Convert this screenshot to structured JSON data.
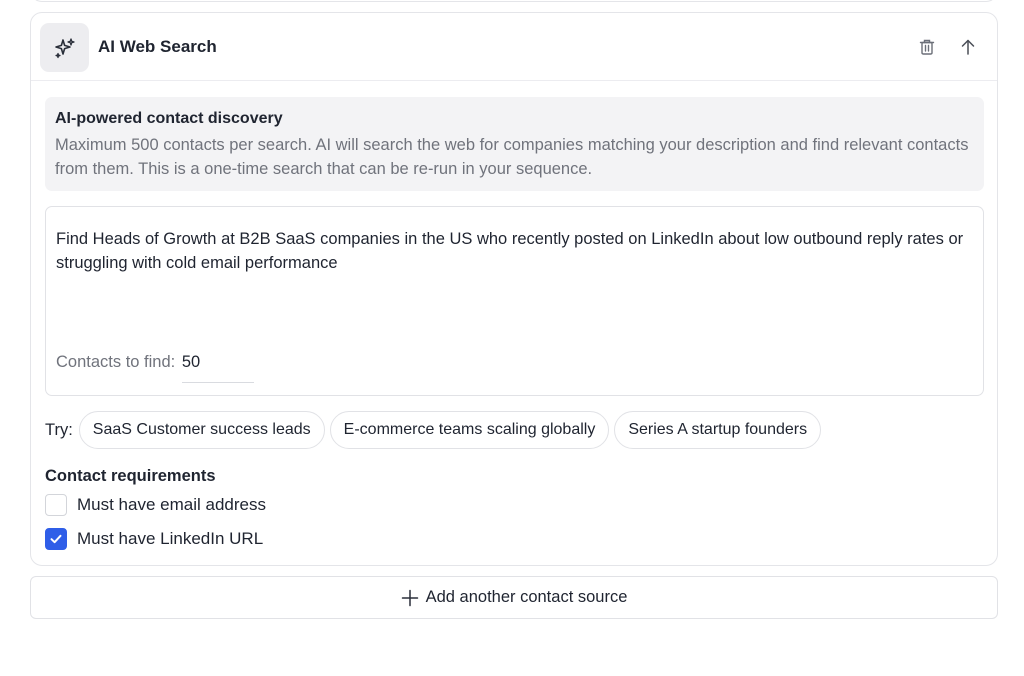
{
  "card": {
    "title": "AI Web Search",
    "header_icon": "sparkles-icon",
    "delete_icon": "trash-icon",
    "move_up_icon": "arrow-up-icon"
  },
  "info": {
    "title": "AI-powered contact discovery",
    "text": "Maximum 500 contacts per search. AI will search the web for companies matching your description and find relevant contacts from them. This is a one-time search that can be re-run in your sequence."
  },
  "prompt": {
    "text": "Find Heads of Growth at B2B SaaS companies in the US who recently posted on LinkedIn about low outbound reply rates or struggling with cold email performance",
    "contacts_label": "Contacts to find:",
    "contacts_value": "50"
  },
  "suggestions": {
    "label": "Try:",
    "chips": [
      "SaaS Customer success leads",
      "E-commerce teams scaling globally",
      "Series A startup founders"
    ]
  },
  "requirements": {
    "title": "Contact requirements",
    "items": [
      {
        "label": "Must have email address",
        "checked": false
      },
      {
        "label": "Must have LinkedIn URL",
        "checked": true
      }
    ]
  },
  "add_source": {
    "label": "Add another contact source",
    "icon": "plus-icon"
  },
  "colors": {
    "accent": "#2f5ee8",
    "muted_text": "#70737c",
    "info_bg": "#f3f3f5"
  }
}
